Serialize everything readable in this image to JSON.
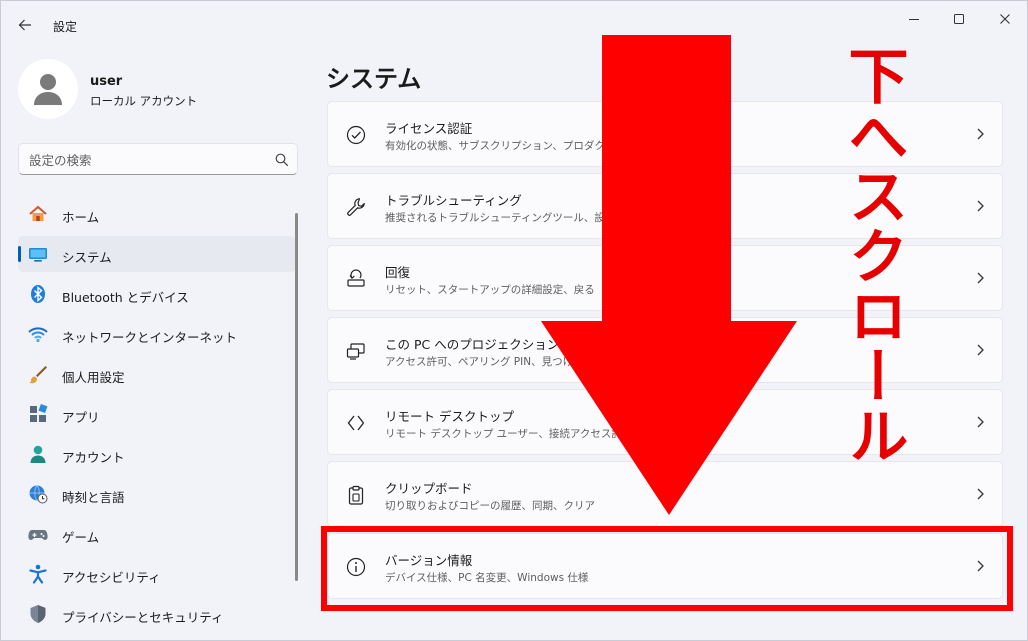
{
  "window": {
    "title": "設定"
  },
  "profile": {
    "name": "user",
    "account_type": "ローカル アカウント"
  },
  "search": {
    "placeholder": "設定の検索"
  },
  "nav": {
    "items": [
      {
        "label": "ホーム",
        "icon": "home-icon"
      },
      {
        "label": "システム",
        "icon": "system-icon",
        "selected": true
      },
      {
        "label": "Bluetooth とデバイス",
        "icon": "bluetooth-icon"
      },
      {
        "label": "ネットワークとインターネット",
        "icon": "wifi-icon"
      },
      {
        "label": "個人用設定",
        "icon": "brush-icon"
      },
      {
        "label": "アプリ",
        "icon": "apps-icon"
      },
      {
        "label": "アカウント",
        "icon": "account-icon"
      },
      {
        "label": "時刻と言語",
        "icon": "globe-clock-icon"
      },
      {
        "label": "ゲーム",
        "icon": "gamepad-icon"
      },
      {
        "label": "アクセシビリティ",
        "icon": "accessibility-icon"
      },
      {
        "label": "プライバシーとセキュリティ",
        "icon": "shield-icon"
      }
    ]
  },
  "main": {
    "title": "システム",
    "cards": [
      {
        "title": "ライセンス認証",
        "description": "有効化の状態、サブスクリプション、プロダクト キー",
        "icon": "check-circle-icon"
      },
      {
        "title": "トラブルシューティング",
        "description": "推奨されるトラブルシューティングツール、設定、履歴",
        "icon": "wrench-icon"
      },
      {
        "title": "回復",
        "description": "リセット、スタートアップの詳細設定、戻る",
        "icon": "recovery-icon"
      },
      {
        "title": "この PC へのプロジェクション",
        "description": "アクセス許可、ペアリング PIN、見つけやすさ",
        "icon": "projection-icon"
      },
      {
        "title": "リモート デスクトップ",
        "description": "リモート デスクトップ ユーザー、接続アクセス許可",
        "icon": "remote-desktop-icon"
      },
      {
        "title": "クリップボード",
        "description": "切り取りおよびコピーの履歴、同期、クリア",
        "icon": "clipboard-icon"
      },
      {
        "title": "バージョン情報",
        "description": "デバイス仕様、PC 名変更、Windows 仕様",
        "icon": "info-icon"
      }
    ]
  },
  "annotation": {
    "text": "下へスクロール",
    "color": "#e60000"
  },
  "colors": {
    "accent": "#005fb8",
    "highlight": "#ff0000"
  }
}
